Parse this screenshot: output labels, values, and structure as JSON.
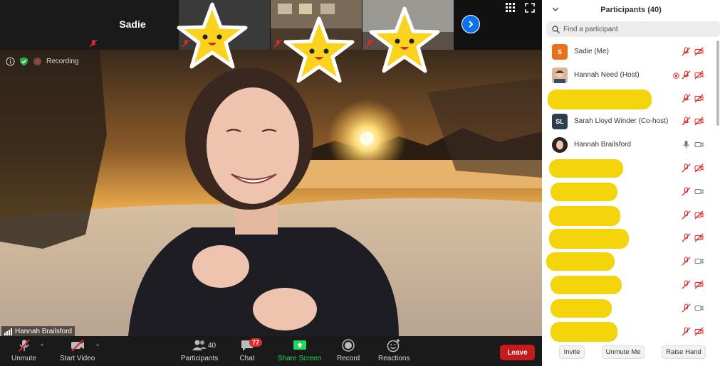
{
  "thumbnails": [
    {
      "name": "Sadie"
    }
  ],
  "video": {
    "recording_label": "Recording",
    "speaker_name": "Hannah Brailsford"
  },
  "toolbar": {
    "unmute_label": "Unmute",
    "start_video_label": "Start Video",
    "participants_label": "Participants",
    "participants_count": "40",
    "chat_label": "Chat",
    "chat_badge": "77",
    "share_screen_label": "Share Screen",
    "record_label": "Record",
    "reactions_label": "Reactions",
    "leave_label": "Leave"
  },
  "panel": {
    "title": "Participants (40)",
    "search_placeholder": "Find a participant",
    "participants": [
      {
        "initials": "S",
        "name": "Sadie (Me)",
        "avatar_color": "#e8711b"
      },
      {
        "initials": "",
        "name": "Hannah Need (Host)",
        "avatar_color": "#b6835c"
      },
      {
        "initials": "",
        "name": "",
        "avatar_color": "#e87a1e"
      },
      {
        "initials": "SL",
        "name": "Sarah Lloyd Winder (Co-host)",
        "avatar_color": "#2d3e4f"
      },
      {
        "initials": "",
        "name": "Hannah Brailsford",
        "avatar_color": "#6b5a52"
      },
      {
        "initials": "",
        "name": "",
        "avatar_color": "#9b8060"
      },
      {
        "initials": "",
        "name": "",
        "avatar_color": "#777777"
      },
      {
        "initials": "",
        "name": "",
        "avatar_color": "#888888"
      },
      {
        "initials": "",
        "name": "",
        "avatar_color": "#9b59b6"
      },
      {
        "initials": "",
        "name": "",
        "avatar_color": "#2ecc71"
      },
      {
        "initials": "",
        "name": "",
        "avatar_color": "#8e44ad"
      },
      {
        "initials": "",
        "name": "",
        "avatar_color": "#27ae60"
      },
      {
        "initials": "",
        "name": "",
        "avatar_color": "#16a085"
      }
    ],
    "footer": {
      "invite_label": "Invite",
      "unmute_me_label": "Unmute Me",
      "raise_hand_label": "Raise Hand"
    }
  },
  "colors": {
    "accent_blue": "#0e72ed",
    "muted_red": "#e02828",
    "share_green": "#23d959",
    "redaction_yellow": "#f4d40a"
  }
}
